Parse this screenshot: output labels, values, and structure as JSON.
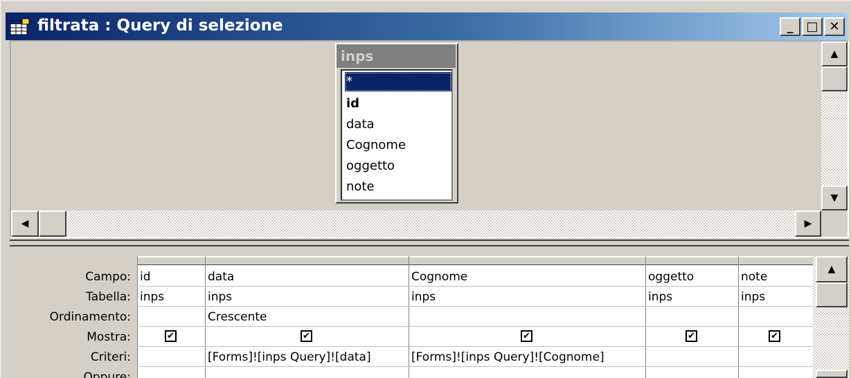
{
  "window": {
    "title": "filtrata : Query di selezione",
    "min_glyph": "_",
    "max_glyph": "□",
    "close_glyph": "✕"
  },
  "table": {
    "name": "inps",
    "fields": [
      "*",
      "id",
      "data",
      "Cognome",
      "oggetto",
      "note"
    ],
    "selected": "*",
    "key_field": "id"
  },
  "grid": {
    "row_labels": [
      "Campo:",
      "Tabella:",
      "Ordinamento:",
      "Mostra:",
      "Criteri:",
      "Oppure:"
    ],
    "columns": [
      {
        "campo": "id",
        "tabella": "inps",
        "ordinamento": "",
        "mostra": true,
        "criteri": ""
      },
      {
        "campo": "data",
        "tabella": "inps",
        "ordinamento": "Crescente",
        "mostra": true,
        "criteri": "[Forms]![inps Query]![data]"
      },
      {
        "campo": "Cognome",
        "tabella": "inps",
        "ordinamento": "",
        "mostra": true,
        "criteri": "[Forms]![inps Query]![Cognome]"
      },
      {
        "campo": "oggetto",
        "tabella": "inps",
        "ordinamento": "",
        "mostra": true,
        "criteri": ""
      },
      {
        "campo": "note",
        "tabella": "inps",
        "ordinamento": "",
        "mostra": true,
        "criteri": ""
      }
    ]
  },
  "icons": {
    "window_icon": "query-icon",
    "scroll_up": "▲",
    "scroll_down": "▼",
    "scroll_left": "◀",
    "scroll_right": "▶",
    "check": "✔"
  },
  "colors": {
    "title_start": "#0a246a",
    "title_end": "#a6caf0",
    "selection": "#0a246a",
    "face": "#d4d0c8"
  }
}
